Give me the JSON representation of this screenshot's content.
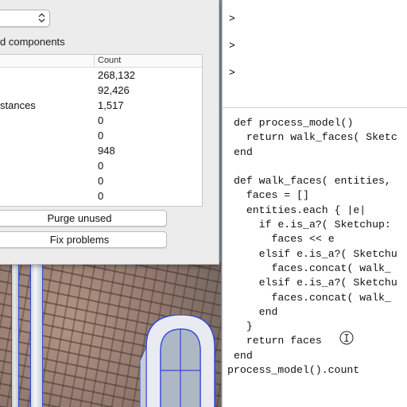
{
  "model_info": {
    "section_title": "d components",
    "table": {
      "count_header": "Count",
      "rows": [
        {
          "name": "",
          "value": "268,132"
        },
        {
          "name": "",
          "value": "92,426"
        },
        {
          "name": "stances",
          "value": "1,517"
        },
        {
          "name": "",
          "value": "0"
        },
        {
          "name": "",
          "value": "0"
        },
        {
          "name": "",
          "value": "948"
        },
        {
          "name": "",
          "value": "0"
        },
        {
          "name": "",
          "value": "0"
        },
        {
          "name": "",
          "value": "0"
        }
      ]
    },
    "purge_button": "Purge unused",
    "fix_button": "Fix problems"
  },
  "console": {
    "prompts": [
      ">",
      ">",
      ">"
    ],
    "code_lines": [
      "def process_model()",
      "  return walk_faces( Sketc",
      "end",
      "",
      "def walk_faces( entities,",
      "  faces = []",
      "  entities.each { |e|",
      "    if e.is_a?( Sketchup:",
      "      faces << e",
      "    elsif e.is_a?( Sketchu",
      "      faces.concat( walk_",
      "    elsif e.is_a?( Sketchu",
      "      faces.concat( walk_",
      "    end",
      "  }",
      "  return faces",
      "end",
      "process_model().count"
    ]
  },
  "icons": {
    "select_arrows": "chevron-updown-icon",
    "text_cursor": "ibeam-cursor-icon"
  },
  "colors": {
    "panel_bg": "#ececec",
    "edge_blue": "#3448d6"
  }
}
